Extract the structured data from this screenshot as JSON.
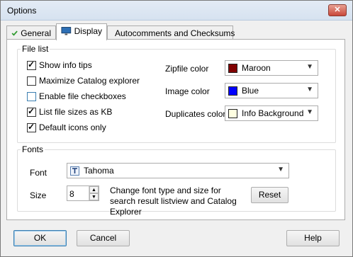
{
  "window": {
    "title": "Options",
    "close_glyph": "✕"
  },
  "tabs": [
    {
      "label": "General",
      "icon": "checkmark-icon"
    },
    {
      "label": "Display",
      "icon": "monitor-icon"
    },
    {
      "label": "Autocomments and Checksums",
      "icon": "comment-icon"
    }
  ],
  "file_list": {
    "legend": "File list",
    "checkboxes": [
      {
        "label": "Show info tips",
        "checked": true
      },
      {
        "label": "Maximize Catalog explorer",
        "checked": false
      },
      {
        "label": "Enable file checkboxes",
        "checked": false
      },
      {
        "label": "List file sizes as KB",
        "checked": true
      },
      {
        "label": "Default icons only",
        "checked": true
      }
    ],
    "colors": [
      {
        "label": "Zipfile color",
        "value": "Maroon",
        "swatch": "#800000"
      },
      {
        "label": "Image color",
        "value": "Blue",
        "swatch": "#0000ff"
      },
      {
        "label": "Duplicates color",
        "value": "Info Background",
        "swatch": "#ffffe1"
      }
    ]
  },
  "fonts": {
    "legend": "Fonts",
    "font_label": "Font",
    "font_value": "Tahoma",
    "size_label": "Size",
    "size_value": "8",
    "description": "Change font type and size for search result listview and Catalog Explorer",
    "reset_label": "Reset"
  },
  "footer": {
    "ok_label": "OK",
    "cancel_label": "Cancel",
    "help_label": "Help"
  }
}
